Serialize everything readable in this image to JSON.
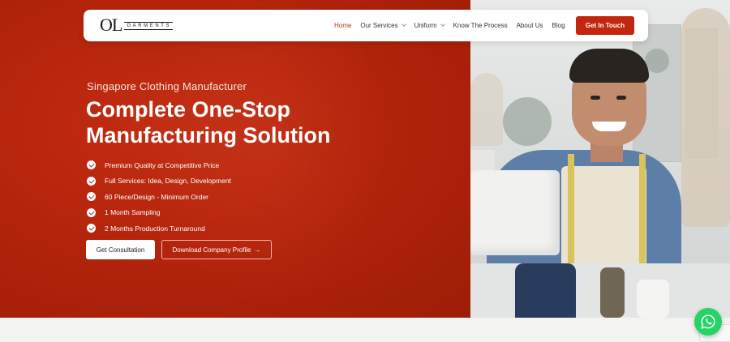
{
  "nav": {
    "logo_mark": "OL",
    "logo_sub": "GARMENTS",
    "links": [
      {
        "label": "Home",
        "active": true
      },
      {
        "label": "Our Services",
        "dropdown": true
      },
      {
        "label": "Uniform",
        "dropdown": true
      },
      {
        "label": "Know The Process"
      },
      {
        "label": "About Us"
      },
      {
        "label": "Blog"
      }
    ],
    "cta_label": "Get In Touch"
  },
  "hero": {
    "eyebrow": "Singapore Clothing Manufacturer",
    "headline_line1": "Complete One-Stop",
    "headline_line2": "Manufacturing Solution",
    "features": [
      "Premium Quality at Competitive Price",
      "Full Services: Idea, Design, Development",
      "60 Piece/Design - Minimum Order",
      "1 Month Sampling",
      "2 Months Production Turnaround"
    ],
    "primary_button": "Get Consultation",
    "secondary_button": "Download Company Profile",
    "secondary_arrow": "→"
  },
  "colors": {
    "brand_red": "#b4240c",
    "cta_red": "#c2260c",
    "whatsapp_green": "#25d366"
  },
  "icons": {
    "feature_bullet": "check-circle-icon",
    "floating": "whatsapp-icon"
  }
}
